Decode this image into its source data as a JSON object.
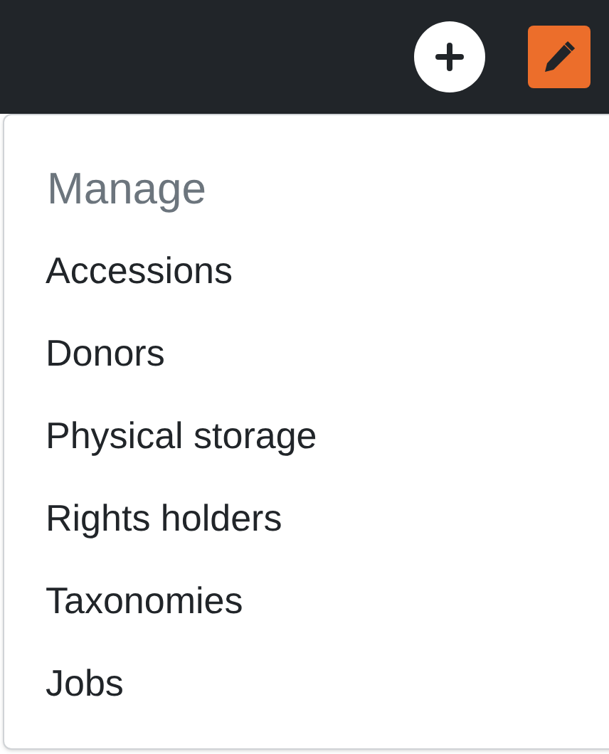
{
  "menu": {
    "header": "Manage",
    "items": [
      {
        "label": "Accessions"
      },
      {
        "label": "Donors"
      },
      {
        "label": "Physical storage"
      },
      {
        "label": "Rights holders"
      },
      {
        "label": "Taxonomies"
      },
      {
        "label": "Jobs"
      }
    ]
  }
}
